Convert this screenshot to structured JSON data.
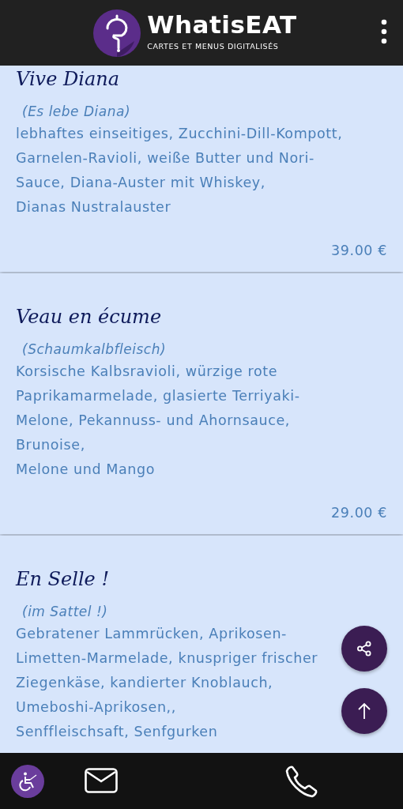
{
  "header": {
    "brand": "WhatisEAT",
    "tagline": "CARTES ET MENUS DIGITALISÉS"
  },
  "dishes": [
    {
      "title": "Vive Diana",
      "subtitle": "(Es lebe Diana)",
      "lines": [
        "lebhaftes einseitiges, Zucchini-Dill-Kompott,",
        "Garnelen-Ravioli, weiße Butter und Nori-",
        "Sauce, Diana-Auster mit Whiskey,",
        "Dianas Nustralauster"
      ],
      "price": "39.00 €"
    },
    {
      "title": "Veau en écume",
      "subtitle": "(Schaumkalbfleisch)",
      "lines": [
        "Korsische Kalbsravioli, würzige rote",
        "Paprikamarmelade, glasierte Terriyaki-",
        "Melone, Pekannuss- und Ahornsauce,",
        "Brunoise,",
        "Melone und Mango"
      ],
      "price": "29.00 €"
    },
    {
      "title": "En Selle !",
      "subtitle": "(im Sattel !)",
      "lines": [
        "Gebratener Lammrücken, Aprikosen-",
        "Limetten-Marmelade, knuspriger frischer",
        "Ziegenkäse, kandierter Knoblauch,",
        "Umeboshi-Aprikosen,,",
        "Senffleischsaft, Senfgurken"
      ]
    }
  ]
}
